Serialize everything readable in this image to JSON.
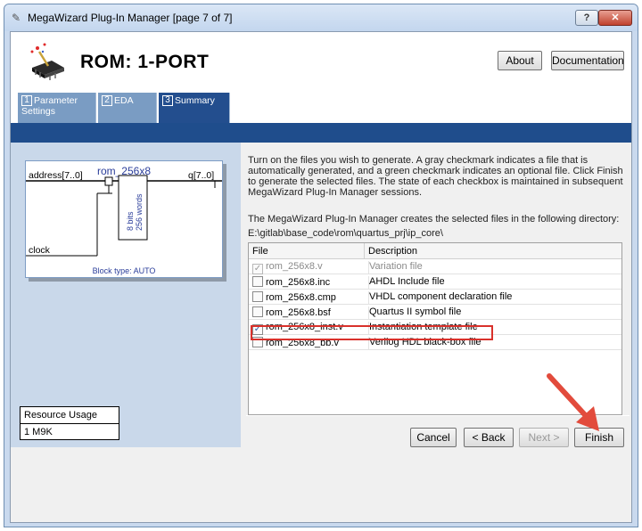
{
  "window": {
    "title": "MegaWizard Plug-In Manager [page 7 of 7]",
    "help_label": "?",
    "close_label": "✕"
  },
  "header": {
    "title": "ROM: 1-PORT",
    "about_label": "About",
    "documentation_label": "Documentation"
  },
  "tabs": [
    {
      "num": "1",
      "label": "Parameter Settings"
    },
    {
      "num": "2",
      "label": "EDA"
    },
    {
      "num": "3",
      "label": "Summary"
    }
  ],
  "symbol": {
    "name": "rom_256x8",
    "address_port": "address[7..0]",
    "q_port": "q[7..0]",
    "clock_port": "clock",
    "bits_label": "8 bits",
    "words_label": "256 words",
    "block_type": "Block type: AUTO"
  },
  "resource": {
    "title": "Resource Usage",
    "value": "1 M9K"
  },
  "summary": {
    "description": "Turn on the files you wish to generate. A gray checkmark indicates a file that is automatically generated, and a green checkmark indicates an optional file. Click Finish to generate the selected files. The state of each checkbox is maintained in subsequent MegaWizard Plug-In Manager sessions.",
    "dir_intro": "The MegaWizard Plug-In Manager creates the selected files in the following directory:",
    "directory": "E:\\gitlab\\base_code\\rom\\quartus_prj\\ip_core\\"
  },
  "files": {
    "header_file": "File",
    "header_desc": "Description",
    "rows": [
      {
        "file": "rom_256x8.v",
        "desc": "Variation file",
        "checked": true,
        "gray": true
      },
      {
        "file": "rom_256x8.inc",
        "desc": "AHDL Include file",
        "checked": false,
        "gray": false
      },
      {
        "file": "rom_256x8.cmp",
        "desc": "VHDL component declaration file",
        "checked": false,
        "gray": false
      },
      {
        "file": "rom_256x8.bsf",
        "desc": "Quartus II symbol file",
        "checked": false,
        "gray": false
      },
      {
        "file": "rom_256x8_inst.v",
        "desc": "Instantiation template file",
        "checked": true,
        "gray": false
      },
      {
        "file": "rom_256x8_bb.v",
        "desc": "Verilog HDL black-box file",
        "checked": false,
        "gray": false
      }
    ]
  },
  "buttons": {
    "cancel": "Cancel",
    "back": "< Back",
    "next": "Next >",
    "finish": "Finish"
  },
  "colors": {
    "accent": "#1f4d8c",
    "highlight": "#d9312b"
  }
}
